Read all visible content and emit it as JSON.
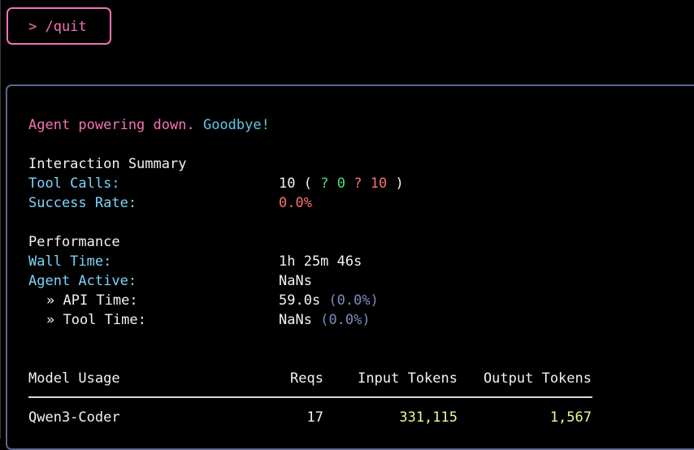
{
  "prompt": {
    "text": "> /quit"
  },
  "panel": {
    "farewell_part1": "Agent powering down.",
    "farewell_part2": "Goodbye!",
    "interaction": {
      "heading": "Interaction Summary",
      "tool_calls_label": "Tool Calls:",
      "tool_calls_total": "10",
      "tool_calls_open": "(",
      "success_icon": "?",
      "success_count": "0",
      "fail_icon": "?",
      "fail_count": "10",
      "tool_calls_close": ")",
      "success_rate_label": "Success Rate:",
      "success_rate_value": "0.0%"
    },
    "performance": {
      "heading": "Performance",
      "wall_time_label": "Wall Time:",
      "wall_time_value": "1h 25m 46s",
      "agent_active_label": "Agent Active:",
      "agent_active_value": "NaNs",
      "api_time_label": "» API Time:",
      "api_time_value": "59.0s",
      "api_time_pct": "(0.0%)",
      "tool_time_label": "» Tool Time:",
      "tool_time_value": "NaNs",
      "tool_time_pct": "(0.0%)"
    },
    "model_usage": {
      "headers": {
        "model": "Model Usage",
        "reqs": "Reqs",
        "input": "Input Tokens",
        "output": "Output Tokens"
      },
      "rows": [
        {
          "model": "Qwen3-Coder",
          "reqs": "17",
          "input": "331,115",
          "output": "1,567"
        }
      ]
    }
  },
  "colors": {
    "accent_pink": "#f472b6",
    "label_cyan": "#7dd3fc",
    "success_green": "#4ade80",
    "error_red": "#f87171",
    "muted_blue": "#7c8dbd",
    "token_yellow": "#f5f59a",
    "panel_border": "#5b6690"
  },
  "icons": {
    "success_icon": "check-icon",
    "fail_icon": "cross-icon"
  }
}
